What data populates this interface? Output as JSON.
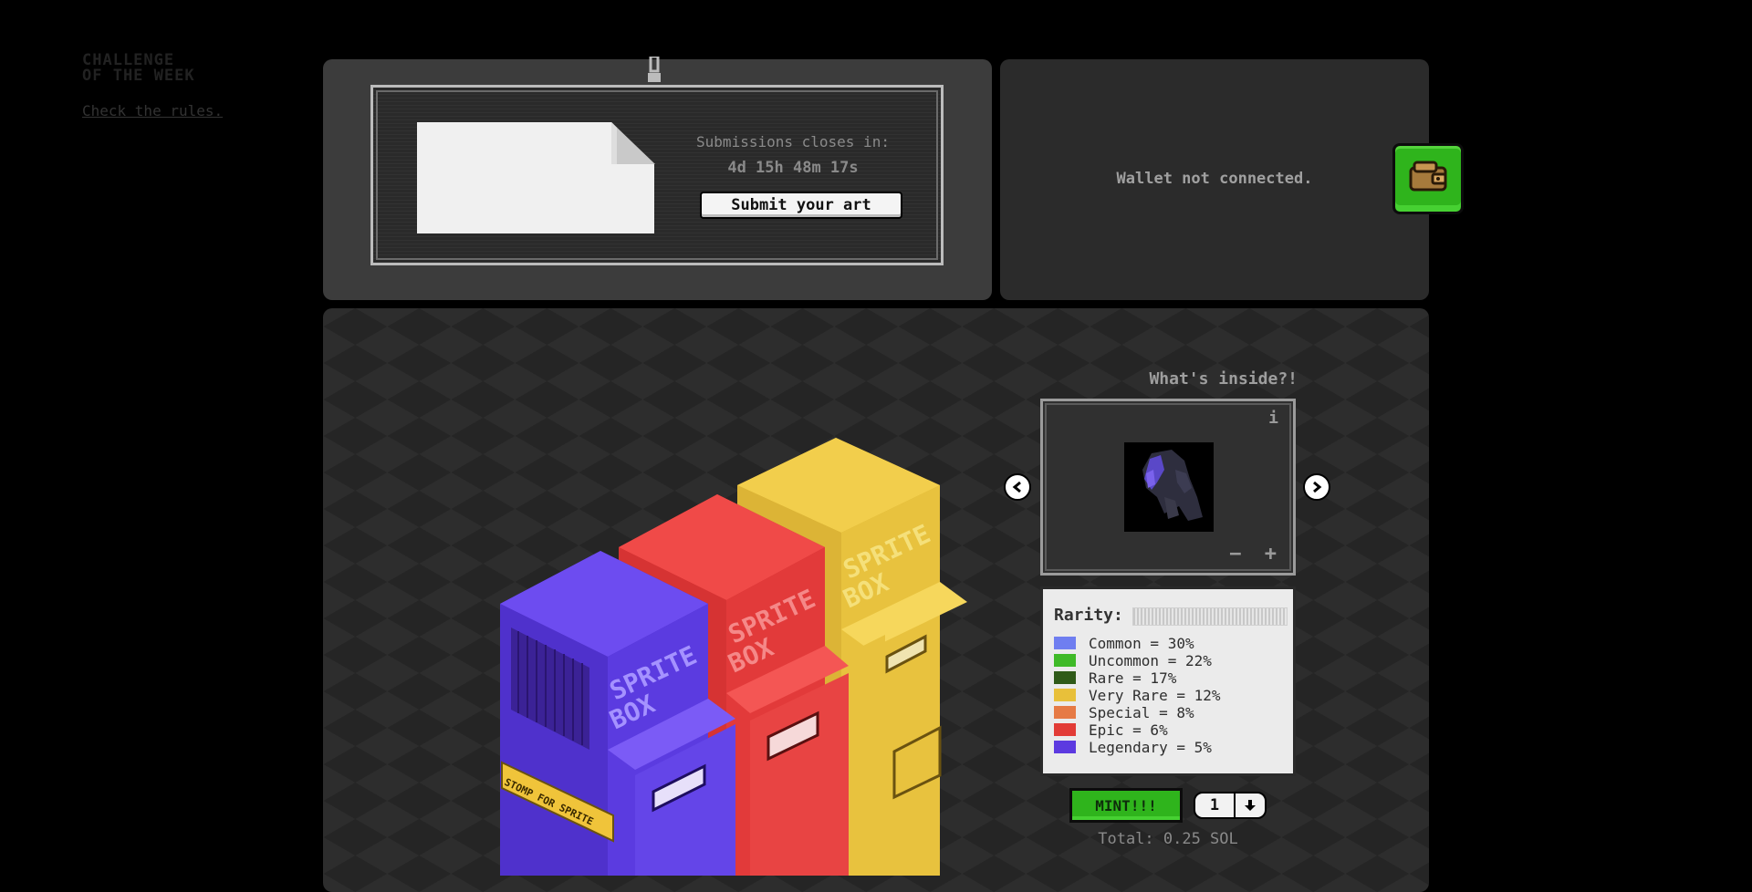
{
  "challenge": {
    "title": "CHALLENGE\nOF THE WEEK",
    "rules_link": "Check the rules.",
    "close_label": "Submissions closes in:",
    "countdown": "4d 15h 48m 17s",
    "submit_label": "Submit your art"
  },
  "wallet": {
    "status": "Wallet not connected.",
    "icon": "wallet-icon"
  },
  "machines": [
    {
      "color": "#5b3be0",
      "label": "SPRITE\nBOX",
      "banner": "STOMP FOR SPRITE"
    },
    {
      "color": "#e8383a",
      "label": "SPRITE\nBOX"
    },
    {
      "color": "#e6c03c",
      "label": "SPRITE\nBOX"
    }
  ],
  "inside": {
    "title": "What's inside?!",
    "info_icon": "i",
    "zoom_label": "− +"
  },
  "rarity": {
    "label": "Rarity:",
    "items": [
      {
        "text": "Common = 30%",
        "color": "#6f7ef0"
      },
      {
        "text": "Uncommon = 22%",
        "color": "#3fba28"
      },
      {
        "text": "Rare = 17%",
        "color": "#2f5a18"
      },
      {
        "text": "Very Rare = 12%",
        "color": "#e8c03a"
      },
      {
        "text": "Special = 8%",
        "color": "#e67a45"
      },
      {
        "text": "Epic = 6%",
        "color": "#e23c36"
      },
      {
        "text": "Legendary = 5%",
        "color": "#5c3ae0"
      }
    ]
  },
  "mint": {
    "button_label": "MINT!!!",
    "quantity": "1",
    "total": "Total: 0.25 SOL"
  }
}
